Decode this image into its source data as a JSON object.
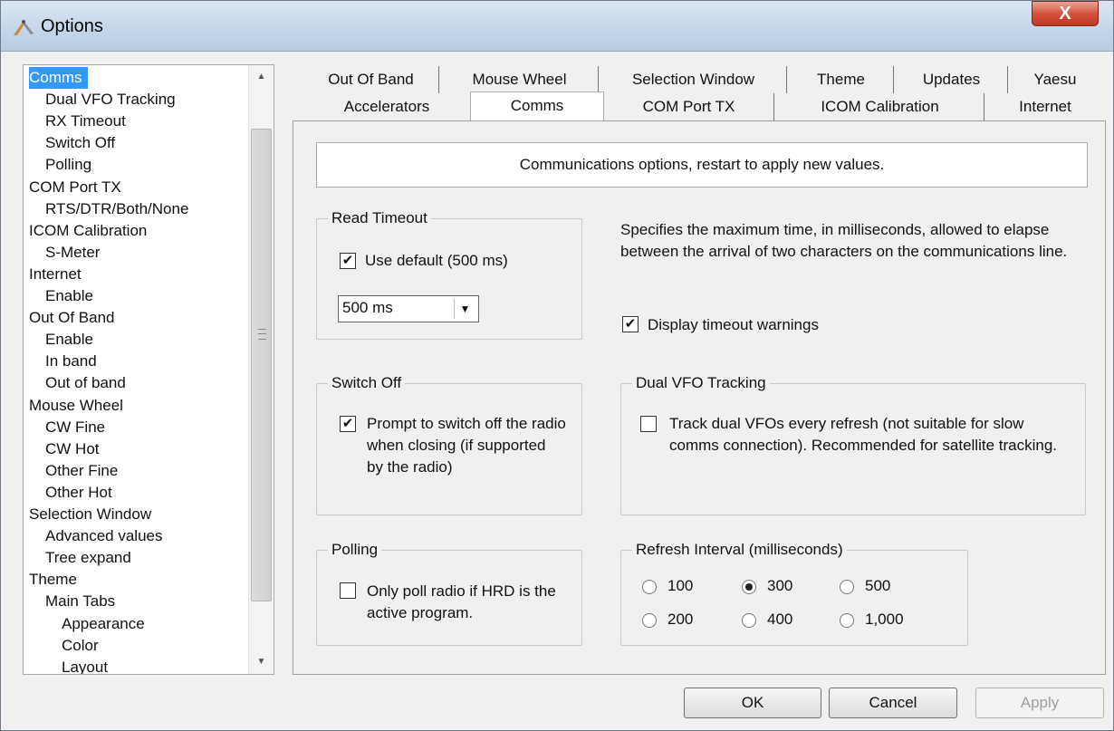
{
  "window": {
    "title": "Options",
    "close_glyph": "X"
  },
  "tree": {
    "items": [
      {
        "label": "Comms",
        "level": 0,
        "selected": true
      },
      {
        "label": "Dual VFO Tracking",
        "level": 1
      },
      {
        "label": "RX Timeout",
        "level": 1
      },
      {
        "label": "Switch Off",
        "level": 1
      },
      {
        "label": "Polling",
        "level": 1
      },
      {
        "label": "COM Port TX",
        "level": 0
      },
      {
        "label": "RTS/DTR/Both/None",
        "level": 1
      },
      {
        "label": "ICOM Calibration",
        "level": 0
      },
      {
        "label": "S-Meter",
        "level": 1
      },
      {
        "label": "Internet",
        "level": 0
      },
      {
        "label": "Enable",
        "level": 1
      },
      {
        "label": "Out Of Band",
        "level": 0
      },
      {
        "label": "Enable",
        "level": 1
      },
      {
        "label": "In band",
        "level": 1
      },
      {
        "label": "Out of band",
        "level": 1
      },
      {
        "label": "Mouse Wheel",
        "level": 0
      },
      {
        "label": "CW Fine",
        "level": 1
      },
      {
        "label": "CW Hot",
        "level": 1
      },
      {
        "label": "Other Fine",
        "level": 1
      },
      {
        "label": "Other Hot",
        "level": 1
      },
      {
        "label": "Selection Window",
        "level": 0
      },
      {
        "label": "Advanced values",
        "level": 1
      },
      {
        "label": "Tree expand",
        "level": 1
      },
      {
        "label": "Theme",
        "level": 0
      },
      {
        "label": "Main Tabs",
        "level": 1
      },
      {
        "label": "Appearance",
        "level": 2
      },
      {
        "label": "Color",
        "level": 2
      },
      {
        "label": "Layout",
        "level": 2
      }
    ]
  },
  "tabs": {
    "row1": [
      "Out Of Band",
      "Mouse Wheel",
      "Selection Window",
      "Theme",
      "Updates",
      "Yaesu"
    ],
    "row2": [
      "Accelerators",
      "Comms",
      "COM Port TX",
      "ICOM Calibration",
      "Internet"
    ],
    "active": "Comms"
  },
  "panel": {
    "info": "Communications options, restart to apply new values.",
    "read_timeout": {
      "title": "Read Timeout",
      "use_default_label": "Use default (500 ms)",
      "use_default_checked": true,
      "dropdown_value": "500 ms"
    },
    "timeout_description": "Specifies the maximum time, in milliseconds, allowed to elapse between the arrival of two characters on the communications line.",
    "display_warnings": {
      "label": "Display timeout warnings",
      "checked": true
    },
    "switch_off": {
      "title": "Switch Off",
      "prompt_label": "Prompt to switch off the radio when closing (if supported by the radio)",
      "prompt_checked": true
    },
    "dual_vfo": {
      "title": "Dual VFO Tracking",
      "track_label": "Track dual VFOs every refresh (not suitable for slow comms connection). Recommended for satellite tracking.",
      "track_checked": false
    },
    "polling": {
      "title": "Polling",
      "only_poll_label": "Only poll radio if HRD is the active program.",
      "only_poll_checked": false
    },
    "refresh": {
      "title": "Refresh Interval (milliseconds)",
      "options": [
        "100",
        "300",
        "500",
        "200",
        "400",
        "1,000"
      ],
      "selected": "300"
    }
  },
  "buttons": {
    "ok": "OK",
    "cancel": "Cancel",
    "apply": "Apply"
  }
}
